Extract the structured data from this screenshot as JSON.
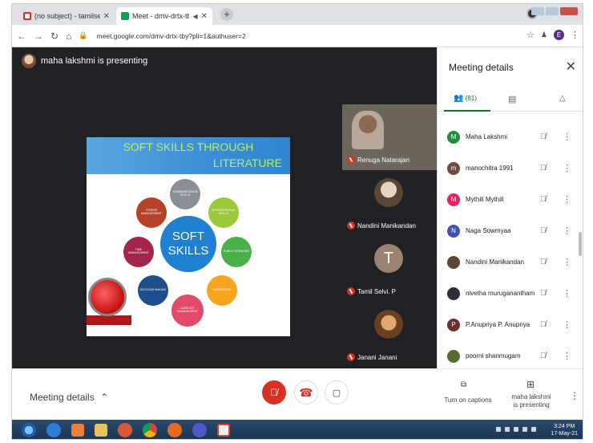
{
  "browser": {
    "tabs": [
      {
        "title": "(no subject) - tamilselvirapunzel",
        "favicon_color": "#d93025"
      },
      {
        "title": "Meet - dmv-drtx-tby",
        "favicon_color": "#0f9d58"
      }
    ],
    "url": "meet.google.com/dmv-drtx-tby?pli=1&authuser=2",
    "profile_initial": "E"
  },
  "meet": {
    "presenting_text": "maha lakshmi is presenting",
    "slide": {
      "title_line1": "SOFT SKILLS THROUGH",
      "title_line2": "LITERATURE",
      "center_line1": "SOFT",
      "center_line2": "SKILLS",
      "bubbles": [
        {
          "label": "COMMUNICATION SKILLS",
          "color": "#8a8f96"
        },
        {
          "label": "INTERPERSONAL SKILLS",
          "color": "#9bc93a"
        },
        {
          "label": "PUBLIC SPEAKING",
          "color": "#4ab04a"
        },
        {
          "label": "LEADERSHIP",
          "color": "#f7a51e"
        },
        {
          "label": "CONFLICT MANAGEMENT",
          "color": "#e24a6a"
        },
        {
          "label": "DECISION MAKING",
          "color": "#1d4e8a"
        },
        {
          "label": "TIME MANAGEMENT",
          "color": "#a4254a"
        },
        {
          "label": "STRESS MANAGEMENT",
          "color": "#b5432a"
        }
      ]
    },
    "tiles": [
      {
        "name": "Renuga Natarajan"
      },
      {
        "name": "Nandini Manikandan"
      },
      {
        "name": "Tamil Selvi. P",
        "initial": "T"
      },
      {
        "name": "Janani Janani"
      }
    ]
  },
  "panel": {
    "title": "Meeting details",
    "people_count": "(81)",
    "participants": [
      {
        "name": "Maha Lakshmi",
        "initial": "M",
        "color": "#1e8e3e"
      },
      {
        "name": "manochitra 1991",
        "initial": "m",
        "color": "#6d4c41"
      },
      {
        "name": "Mythili Mythili",
        "initial": "M",
        "color": "#e91e63"
      },
      {
        "name": "Naga Sowmyaa",
        "initial": "N",
        "color": "#3f51b5"
      },
      {
        "name": "Nandini Manikandan",
        "initial": "",
        "color": "#5a4632"
      },
      {
        "name": "nivetha muruganantham",
        "initial": "",
        "color": "#2a2f3a"
      },
      {
        "name": "P.Anupriya P. Anupriya",
        "initial": "P",
        "color": "#6d2e2e"
      },
      {
        "name": "poorni shanmugam",
        "initial": "",
        "color": "#556b2f"
      }
    ]
  },
  "bottom": {
    "meeting_details": "Meeting details",
    "captions_label": "Turn on captions",
    "presenting_line1": "maha lakshmi",
    "presenting_line2": "is presenting"
  },
  "taskbar": {
    "time": "3:24 PM",
    "date": "17-May-21"
  },
  "colors": {
    "stage_bg": "#202124",
    "end_call_red": "#d93025",
    "accent_green": "#137333"
  }
}
